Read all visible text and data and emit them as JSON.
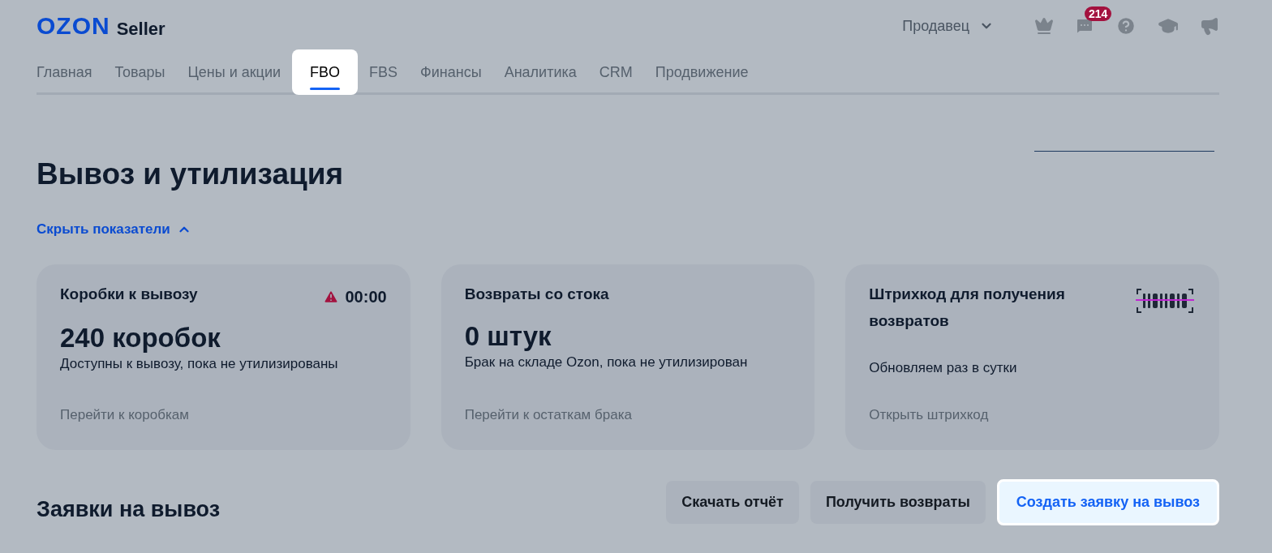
{
  "header": {
    "logo": "OZON",
    "logo_suffix": "Seller",
    "role_menu": "Продавец",
    "chat_badge": "214"
  },
  "tabs": [
    {
      "label": "Главная",
      "selected": false
    },
    {
      "label": "Товары",
      "selected": false
    },
    {
      "label": "Цены и акции",
      "selected": false
    },
    {
      "label": "FBO",
      "selected": true
    },
    {
      "label": "FBS",
      "selected": false
    },
    {
      "label": "Финансы",
      "selected": false
    },
    {
      "label": "Аналитика",
      "selected": false
    },
    {
      "label": "CRM",
      "selected": false
    },
    {
      "label": "Продвижение",
      "selected": false
    }
  ],
  "page_title": "Вывоз и утилизация",
  "toggle_link": {
    "label": "Скрыть показатели",
    "expanded": true
  },
  "cards": [
    {
      "kind": "timer",
      "title": "Коробки к вывозу",
      "timer": "00:00",
      "value": "240 коробок",
      "description": "Доступны к вывозу, пока не утилизированы",
      "link": "Перейти к коробкам"
    },
    {
      "kind": "plain",
      "title": "Возвраты со стока",
      "value": "0 штук",
      "description": "Брак на складе Ozon, пока не утилизирован",
      "link": "Перейти к остаткам брака"
    },
    {
      "kind": "barcode",
      "title": "Штрихкод для получения возвратов",
      "description": "Обновляем раз в сутки",
      "link": "Открыть штрихкод"
    }
  ],
  "section_title": "Заявки на вывоз",
  "buttons": [
    {
      "label": "Скачать отчёт",
      "kind": "secondary"
    },
    {
      "label": "Получить возвраты",
      "kind": "secondary"
    },
    {
      "label": "Создать заявку на вывоз",
      "kind": "primary"
    }
  ]
}
